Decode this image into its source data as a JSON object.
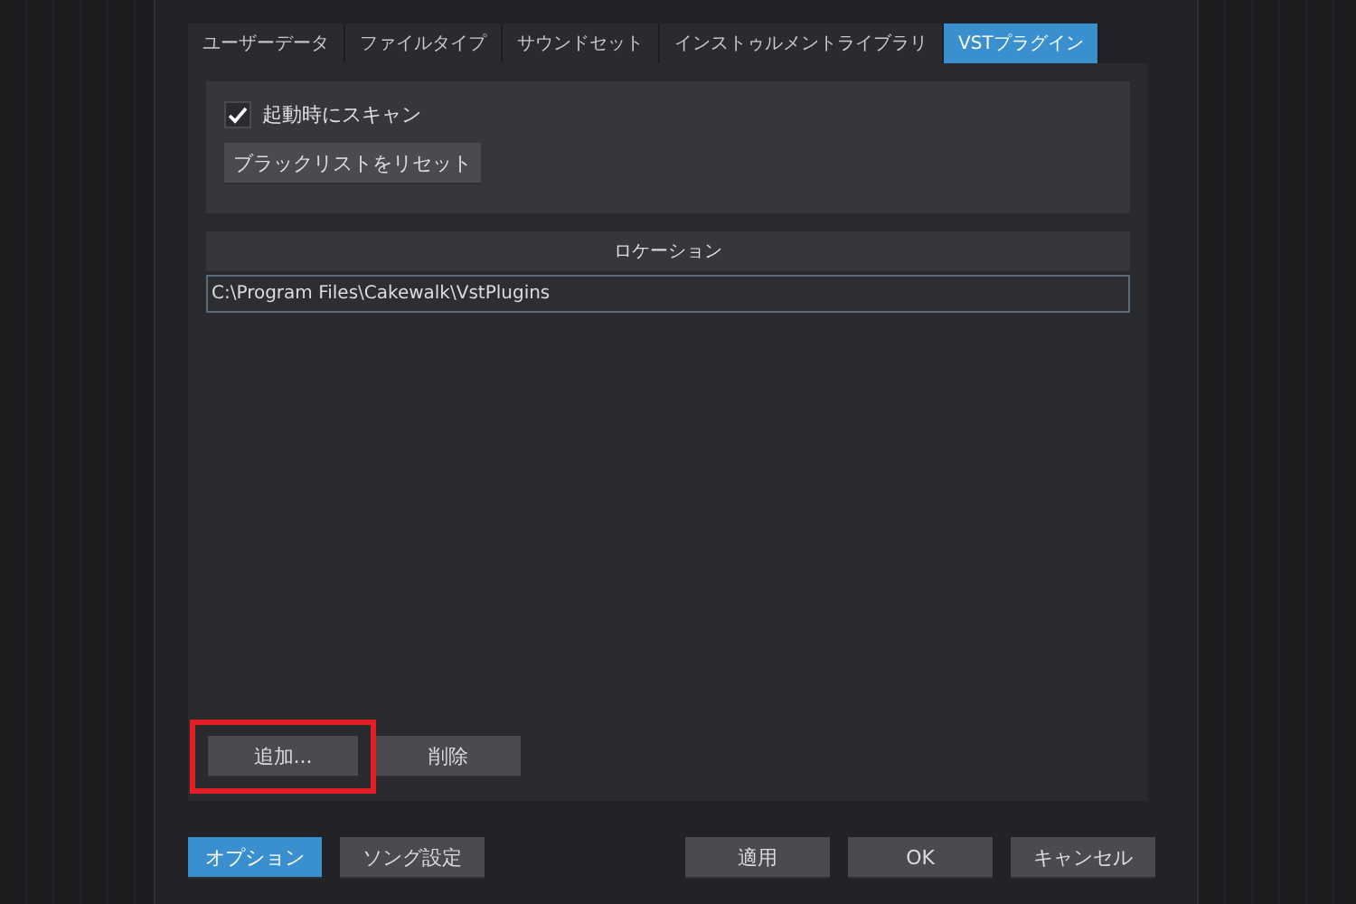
{
  "tabs": [
    {
      "label": "ユーザーデータ",
      "selected": false
    },
    {
      "label": "ファイルタイプ",
      "selected": false
    },
    {
      "label": "サウンドセット",
      "selected": false
    },
    {
      "label": "インストゥルメントライブラリ",
      "selected": false
    },
    {
      "label": "VSTプラグイン",
      "selected": true
    }
  ],
  "scan_on_startup": {
    "label": "起動時にスキャン",
    "checked": true
  },
  "reset_blacklist_button": "ブラックリストをリセット",
  "locations": {
    "header": "ロケーション",
    "rows": [
      {
        "path": "C:\\Program Files\\Cakewalk\\VstPlugins",
        "selected": true
      }
    ]
  },
  "add_button": {
    "label": "追加...",
    "highlighted": true
  },
  "remove_button": "削除",
  "footer_left": [
    {
      "label": "オプション",
      "selected": true
    },
    {
      "label": "ソング設定",
      "selected": false
    }
  ],
  "footer_right": [
    "適用",
    "OK",
    "キャンセル"
  ]
}
